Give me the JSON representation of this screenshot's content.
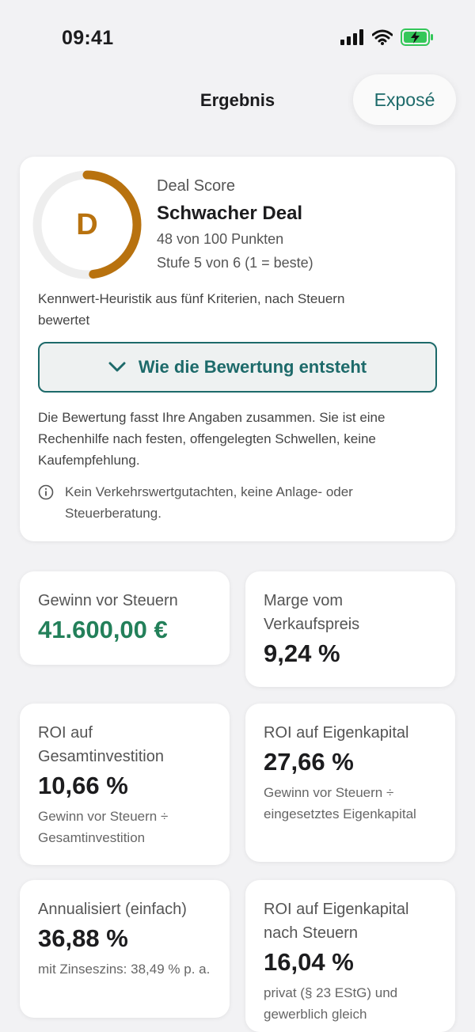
{
  "status": {
    "time": "09:41"
  },
  "nav": {
    "title": "Ergebnis",
    "expose_label": "Exposé"
  },
  "score": {
    "letter": "D",
    "label": "Deal Score",
    "title": "Schwacher Deal",
    "points": "48 von 100 Punkten",
    "points_value": 48,
    "level": "Stufe 5 von 6 (1 = beste)",
    "note": "Kennwert-Heuristik aus fünf Kriterien, nach Steuern bewertet",
    "explain_label": "Wie die Bewertung entsteht",
    "disclaimer": "Die Bewertung fasst Ihre Angaben zusammen. Sie ist eine Rechenhilfe nach festen, offengelegten Schwellen, keine Kaufempfehlung.",
    "hint": "Kein Verkehrswertgutachten, keine Anlage- oder Steuerberatung.",
    "accent": "#b8720f"
  },
  "metrics": {
    "profit": {
      "label": "Gewinn vor Steuern",
      "value": "41.600,00 €"
    },
    "margin": {
      "label": "Marge vom Verkaufspreis",
      "value": "9,24 %"
    },
    "roi_total": {
      "label": "ROI auf Gesamtinvestition",
      "value": "10,66 %",
      "sub": "Gewinn vor Steuern ÷ Gesamtinvestition"
    },
    "roi_equity": {
      "label": "ROI auf Eigenkapital",
      "value": "27,66 %",
      "sub": "Gewinn vor Steuern ÷ eingesetztes Eigenkapital"
    },
    "annualized": {
      "label": "Annualisiert (einfach)",
      "value": "36,88 %",
      "sub": "mit Zinseszins: 38,49 % p. a."
    },
    "roi_equity_tax": {
      "label": "ROI auf Eigenkapital nach Steuern",
      "value": "16,04 %",
      "sub": "privat (§ 23 EStG) und gewerblich gleich"
    }
  },
  "colors": {
    "accent": "#1d6a6a",
    "positive": "#23805a"
  }
}
